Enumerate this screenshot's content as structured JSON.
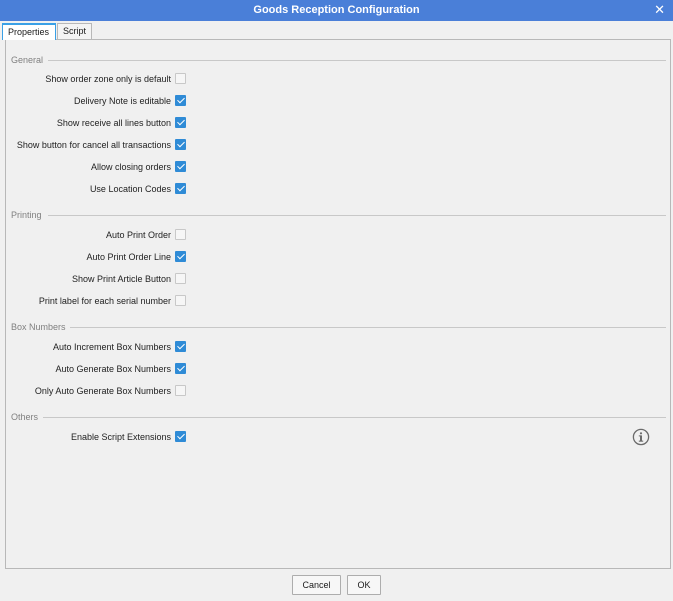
{
  "window": {
    "title": "Goods Reception Configuration",
    "close_glyph": "✕"
  },
  "tabs": [
    {
      "label": "Properties",
      "active": true
    },
    {
      "label": "Script",
      "active": false
    }
  ],
  "sections": {
    "general": {
      "header": "General",
      "rows": [
        {
          "label": "Show order zone only is default",
          "checked": false
        },
        {
          "label": "Delivery Note is editable",
          "checked": true
        },
        {
          "label": "Show receive all lines button",
          "checked": true
        },
        {
          "label": "Show button for cancel all transactions",
          "checked": true
        },
        {
          "label": "Allow closing orders",
          "checked": true
        },
        {
          "label": "Use Location Codes",
          "checked": true
        }
      ]
    },
    "printing": {
      "header": "Printing",
      "rows": [
        {
          "label": "Auto Print Order",
          "checked": false
        },
        {
          "label": "Auto Print Order Line",
          "checked": true
        },
        {
          "label": "Show Print Article Button",
          "checked": false
        },
        {
          "label": "Print label for each serial number",
          "checked": false
        }
      ]
    },
    "box_numbers": {
      "header": "Box Numbers",
      "rows": [
        {
          "label": "Auto Increment Box Numbers",
          "checked": true
        },
        {
          "label": "Auto Generate Box Numbers",
          "checked": true
        },
        {
          "label": "Only Auto Generate Box Numbers",
          "checked": false
        }
      ]
    },
    "others": {
      "header": "Others",
      "rows": [
        {
          "label": "Enable Script Extensions",
          "checked": true
        }
      ]
    }
  },
  "footer": {
    "cancel_label": "Cancel",
    "ok_label": "OK"
  },
  "colors": {
    "titlebar": "#4a7fd8",
    "checkbox_checked": "#2f8bd6",
    "active_tab_accent": "#3aa0e6"
  },
  "icons": {
    "info": "info-circle-icon",
    "close": "close-icon"
  }
}
